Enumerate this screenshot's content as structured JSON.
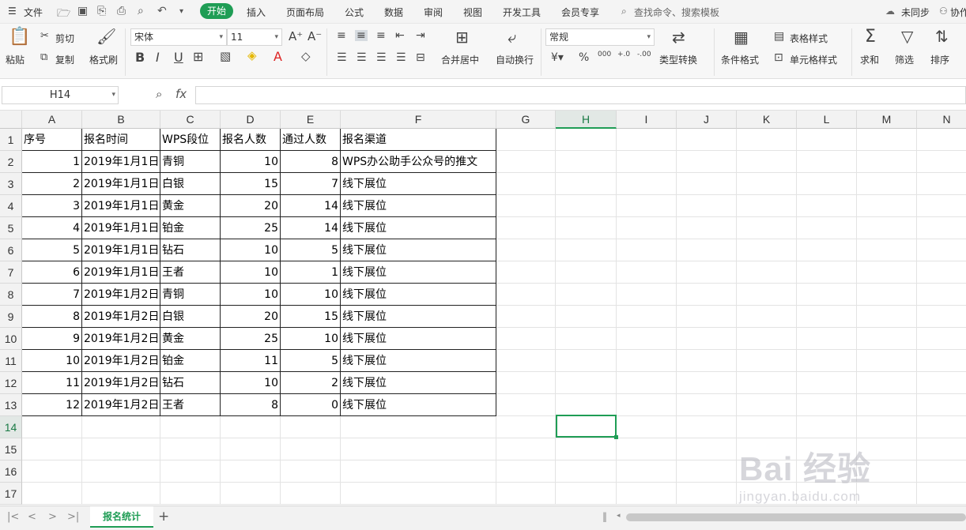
{
  "menu": {
    "file": "文件",
    "tabs": [
      "开始",
      "插入",
      "页面布局",
      "公式",
      "数据",
      "审阅",
      "视图",
      "开发工具",
      "会员专享"
    ],
    "search_placeholder": "查找命令、搜索模板",
    "sync": "未同步",
    "collab": "协作"
  },
  "ribbon": {
    "paste": "粘贴",
    "cut": "剪切",
    "copy": "复制",
    "format_painter": "格式刷",
    "font_name": "宋体",
    "font_size": "11",
    "merge_center": "合并居中",
    "wrap_text": "自动换行",
    "number_format": "常规",
    "type_convert": "类型转换",
    "conditional_format": "条件格式",
    "table_style": "表格样式",
    "cell_style": "单元格样式",
    "sum": "求和",
    "filter": "筛选",
    "sort": "排序"
  },
  "formula_bar": {
    "name_box": "H14",
    "fx": "fx",
    "value": ""
  },
  "sheet": {
    "columns": [
      "A",
      "B",
      "C",
      "D",
      "E",
      "F",
      "G",
      "H",
      "I",
      "J",
      "K",
      "L",
      "M",
      "N"
    ],
    "rows": [
      "1",
      "2",
      "3",
      "4",
      "5",
      "6",
      "7",
      "8",
      "9",
      "10",
      "11",
      "12",
      "13",
      "14",
      "15",
      "16",
      "17"
    ],
    "header": [
      "序号",
      "报名时间",
      "WPS段位",
      "报名人数",
      "通过人数",
      "报名渠道"
    ],
    "data": [
      [
        "1",
        "2019年1月1日",
        "青铜",
        "10",
        "8",
        "WPS办公助手公众号的推文"
      ],
      [
        "2",
        "2019年1月1日",
        "白银",
        "15",
        "7",
        "线下展位"
      ],
      [
        "3",
        "2019年1月1日",
        "黄金",
        "20",
        "14",
        "线下展位"
      ],
      [
        "4",
        "2019年1月1日",
        "铂金",
        "25",
        "14",
        "线下展位"
      ],
      [
        "5",
        "2019年1月1日",
        "钻石",
        "10",
        "5",
        "线下展位"
      ],
      [
        "6",
        "2019年1月1日",
        "王者",
        "10",
        "1",
        "线下展位"
      ],
      [
        "7",
        "2019年1月2日",
        "青铜",
        "10",
        "10",
        "线下展位"
      ],
      [
        "8",
        "2019年1月2日",
        "白银",
        "20",
        "15",
        "线下展位"
      ],
      [
        "9",
        "2019年1月2日",
        "黄金",
        "25",
        "10",
        "线下展位"
      ],
      [
        "10",
        "2019年1月2日",
        "铂金",
        "11",
        "5",
        "线下展位"
      ],
      [
        "11",
        "2019年1月2日",
        "钻石",
        "10",
        "2",
        "线下展位"
      ],
      [
        "12",
        "2019年1月2日",
        "王者",
        "8",
        "0",
        "线下展位"
      ]
    ],
    "selected_column": "H",
    "selected_row": "14"
  },
  "tabs": {
    "sheet_name": "报名统计",
    "add": "+"
  },
  "watermark": {
    "brand": "Bai 经验",
    "url": "jingyan.baidu.com"
  },
  "colors": {
    "accent": "#1f9d55"
  }
}
